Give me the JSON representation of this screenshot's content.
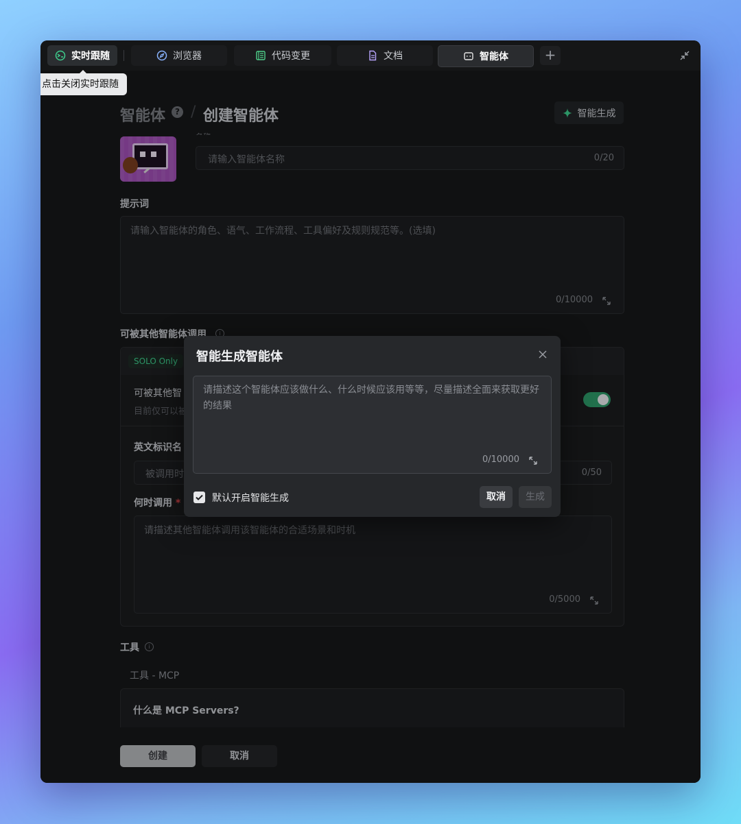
{
  "tabs": [
    {
      "label": "实时跟随",
      "icon": "live-follow-icon"
    },
    {
      "label": "浏览器",
      "icon": "compass-icon"
    },
    {
      "label": "代码变更",
      "icon": "code-diff-icon"
    },
    {
      "label": "文档",
      "icon": "document-icon"
    },
    {
      "label": "智能体",
      "icon": "agent-icon"
    }
  ],
  "tooltip": "点击关闭实时跟随",
  "header": {
    "breadcrumb_root": "智能体",
    "breadcrumb_sep": "/",
    "title": "创建智能体",
    "ai_generate": "智能生成"
  },
  "name": {
    "label": "名称",
    "placeholder": "请输入智能体名称",
    "counter": "0/20"
  },
  "prompt": {
    "label": "提示词",
    "placeholder": "请输入智能体的角色、语气、工作流程、工具偏好及规则规范等。(选填)",
    "counter": "0/10000"
  },
  "callable": {
    "label": "可被其他智能体调用",
    "badge": "SOLO Only",
    "toggle_title": "可被其他智",
    "toggle_desc": "目前仅可以被",
    "toggle_on": true,
    "eng_name_label": "英文标识名",
    "eng_name_placeholder": "被调用时",
    "eng_name_counter": "0/50",
    "when_label": "何时调用",
    "when_required": "*",
    "when_placeholder": "请描述其他智能体调用该智能体的合适场景和时机",
    "when_counter": "0/5000"
  },
  "tools": {
    "label": "工具",
    "sub": "工具 - MCP",
    "faq": "什么是 MCP Servers?"
  },
  "footer": {
    "create": "创建",
    "cancel": "取消"
  },
  "modal": {
    "title": "智能生成智能体",
    "placeholder": "请描述这个智能体应该做什么、什么时候应该用等等，尽量描述全面来获取更好的结果",
    "counter": "0/10000",
    "checkbox_label": "默认开启智能生成",
    "checkbox_checked": true,
    "cancel": "取消",
    "generate": "生成"
  },
  "colors": {
    "accent_green": "#2e9b6a",
    "sparkle": "#3ecf8e"
  }
}
